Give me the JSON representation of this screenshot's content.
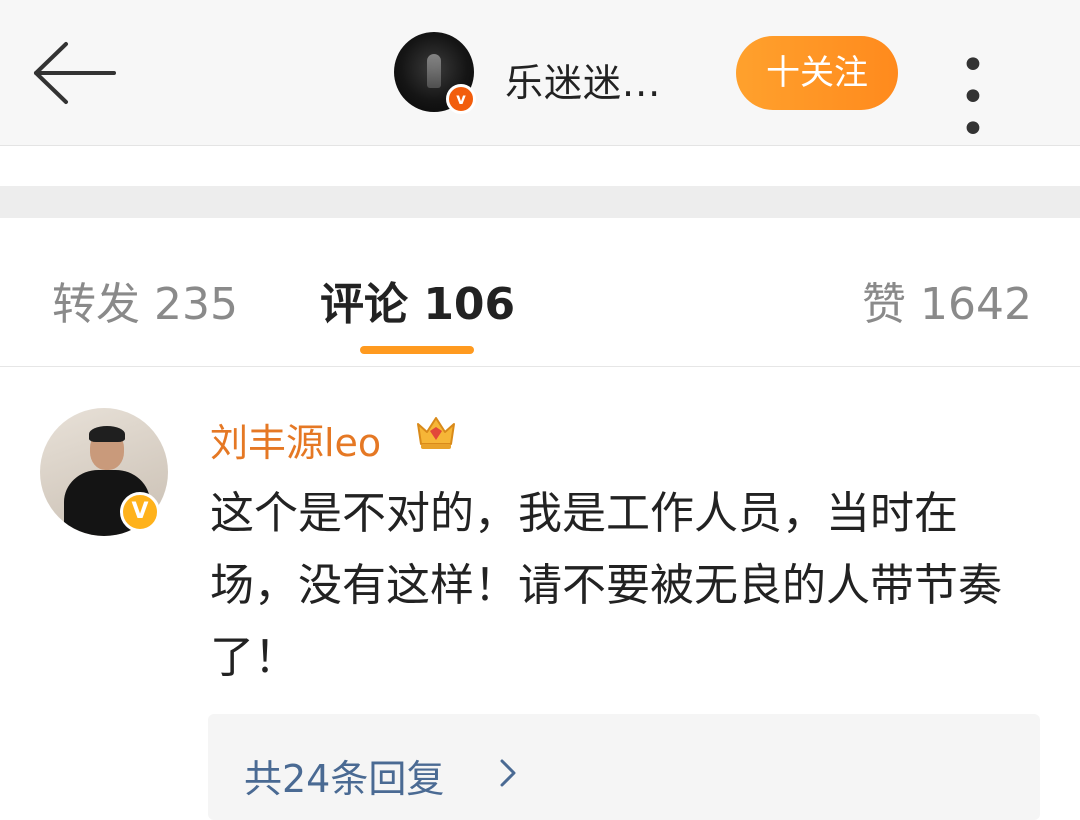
{
  "header": {
    "back_icon": "arrow-left-icon",
    "account_name": "乐迷迷...",
    "follow_label": "十关注",
    "more_icon": "more-dots-icon",
    "more_label": "• • •"
  },
  "tabs": [
    {
      "label": "转发 235",
      "active": false
    },
    {
      "label": "评论 106",
      "active": true
    },
    {
      "label": "赞 1642",
      "active": false
    }
  ],
  "comment": {
    "author": "刘丰源leo",
    "badge_label": "V",
    "member_icon": "crown-icon",
    "text": "这个是不对的，我是工作人员，当时在场，没有这样！请不要被无良的人带节奏了！",
    "replies_label": "共24条回复"
  },
  "colors": {
    "accent_orange": "#ff9a1f",
    "name_orange": "#e57824",
    "link_blue": "#4a6a93",
    "verified_red": "#f25d0c",
    "verified_gold": "#ffb21b"
  }
}
